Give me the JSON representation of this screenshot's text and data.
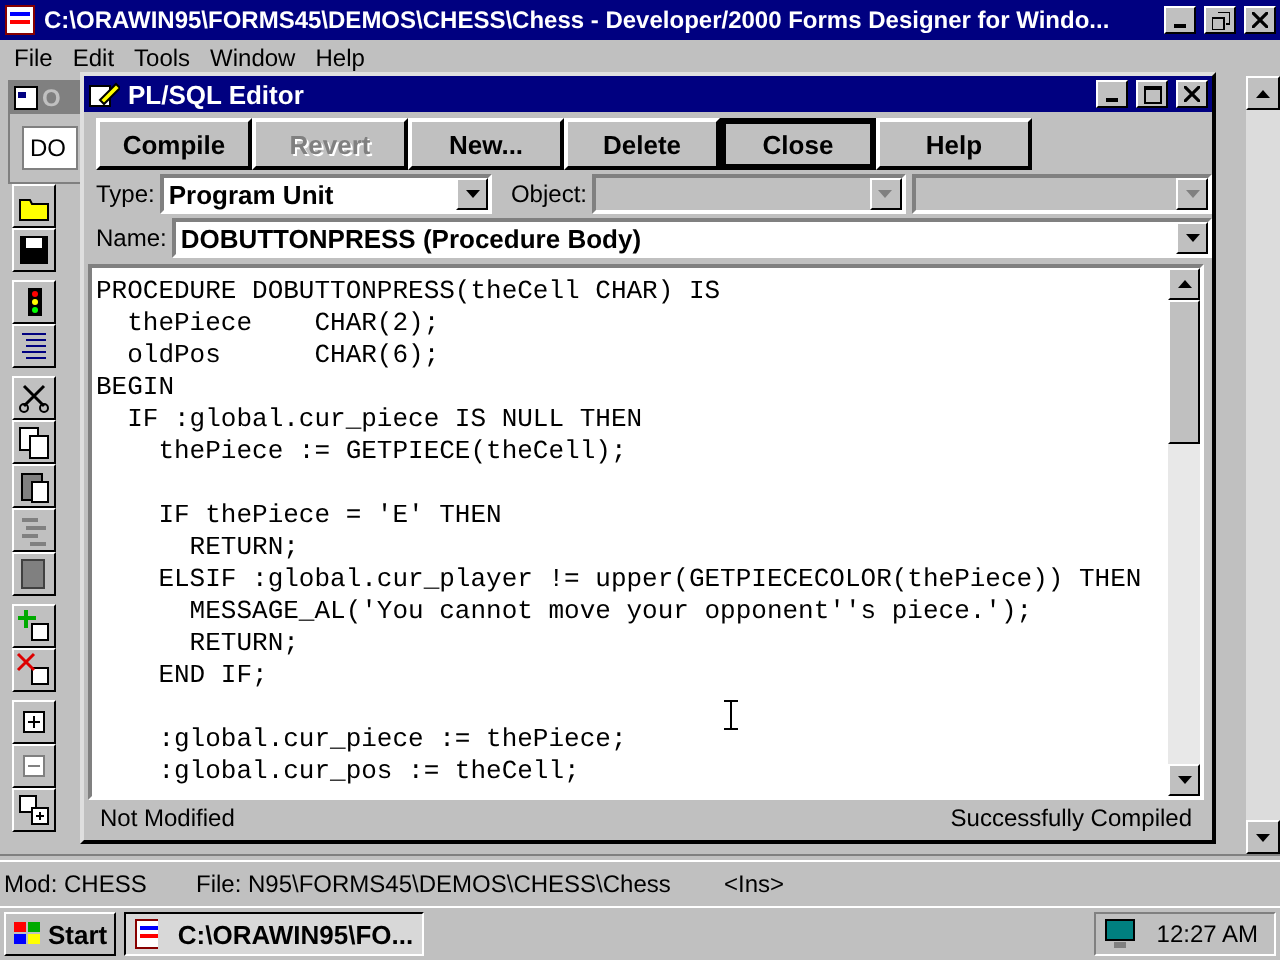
{
  "window": {
    "title": "C:\\ORAWIN95\\FORMS45\\DEMOS\\CHESS\\Chess - Developer/2000 Forms Designer for Windo..."
  },
  "menu": [
    "File",
    "Edit",
    "Tools",
    "Window",
    "Help"
  ],
  "navigator": {
    "title": "O",
    "field": "DO"
  },
  "editor": {
    "title": "PL/SQL Editor",
    "buttons": [
      {
        "label": "Compile",
        "disabled": false,
        "default": false
      },
      {
        "label": "Revert",
        "disabled": true,
        "default": false
      },
      {
        "label": "New...",
        "disabled": false,
        "default": false
      },
      {
        "label": "Delete",
        "disabled": false,
        "default": false
      },
      {
        "label": "Close",
        "disabled": false,
        "default": true
      },
      {
        "label": "Help",
        "disabled": false,
        "default": false
      }
    ],
    "type_label": "Type:",
    "type_value": "Program Unit",
    "object_label": "Object:",
    "name_label": "Name:",
    "name_value": "DOBUTTONPRESS (Procedure Body)",
    "code": [
      {
        "text": "PROCEDURE DOBUTTONPRESS(theCell CHAR) IS",
        "blank_before": false
      },
      {
        "text": "  thePiece    CHAR(2);",
        "blank_before": false
      },
      {
        "text": "  oldPos      CHAR(6);",
        "blank_before": false
      },
      {
        "text": "BEGIN",
        "blank_before": false
      },
      {
        "text": "  IF :global.cur_piece IS NULL THEN",
        "blank_before": false
      },
      {
        "text": "    thePiece := GETPIECE(theCell);",
        "blank_before": false
      },
      {
        "text": "    IF thePiece = 'E' THEN",
        "blank_before": true
      },
      {
        "text": "      RETURN;",
        "blank_before": false
      },
      {
        "text": "    ELSIF :global.cur_player != upper(GETPIECECOLOR(thePiece)) THEN",
        "blank_before": false
      },
      {
        "text": "      MESSAGE_AL('You cannot move your opponent''s piece.');",
        "blank_before": false
      },
      {
        "text": "      RETURN;",
        "blank_before": false
      },
      {
        "text": "    END IF;",
        "blank_before": false
      },
      {
        "text": "    :global.cur_piece := thePiece;",
        "blank_before": true
      },
      {
        "text": "    :global.cur_pos := theCell;",
        "blank_before": false
      }
    ],
    "status_left": "Not Modified",
    "status_right": "Successfully Compiled"
  },
  "status_bar": {
    "module": "Mod: CHESS",
    "file": "File: N95\\FORMS45\\DEMOS\\CHESS\\Chess",
    "mode": "<Ins>"
  },
  "taskbar": {
    "start": "Start",
    "task": "C:\\ORAWIN95\\FO...",
    "time": "12:27 AM"
  }
}
